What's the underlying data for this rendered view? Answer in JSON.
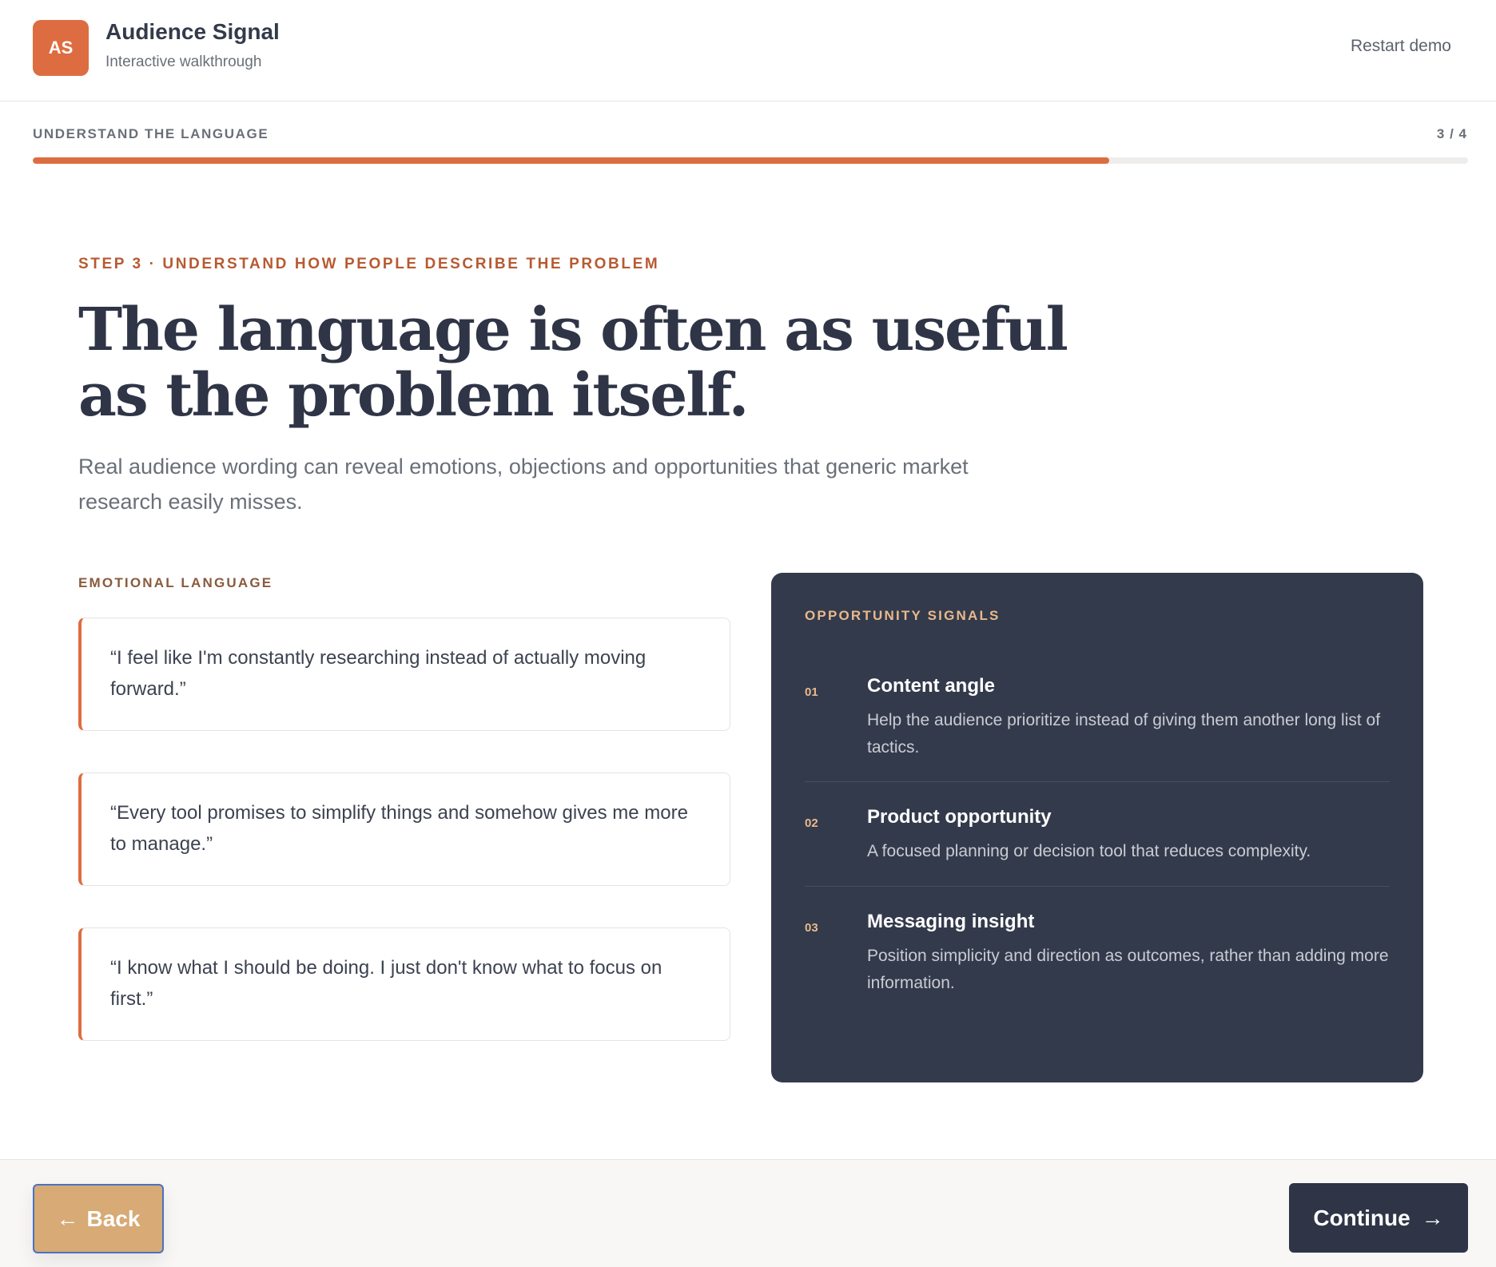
{
  "header": {
    "logo_text": "AS",
    "app_title": "Audience Signal",
    "app_subtitle": "Interactive walkthrough",
    "restart_label": "Restart demo"
  },
  "progress": {
    "label": "UNDERSTAND THE LANGUAGE",
    "count": "3 / 4",
    "fraction": 0.75,
    "accent_color": "#dd6d40"
  },
  "hero": {
    "eyebrow": "STEP 3 · UNDERSTAND HOW PEOPLE DESCRIBE THE PROBLEM",
    "headline": "The language is often as useful as the problem itself.",
    "lede": "Real audience wording can reveal emotions, objections and opportunities that generic market research easily misses."
  },
  "emotional": {
    "label": "EMOTIONAL LANGUAGE",
    "quotes": [
      "“I feel like I'm constantly researching instead of actually moving forward.”",
      "“Every tool promises to simplify things and somehow gives me more to manage.”",
      "“I know what I should be doing. I just don't know what to focus on first.”"
    ]
  },
  "opportunities": {
    "label": "OPPORTUNITY SIGNALS",
    "items": [
      {
        "num": "01",
        "title": "Content angle",
        "desc": "Help the audience prioritize instead of giving them another long list of tactics."
      },
      {
        "num": "02",
        "title": "Product opportunity",
        "desc": "A focused planning or decision tool that reduces complexity."
      },
      {
        "num": "03",
        "title": "Messaging insight",
        "desc": "Position simplicity and direction as outcomes, rather than adding more information."
      }
    ]
  },
  "footer": {
    "back_arrow": "←",
    "back_label": "Back",
    "continue_label": "Continue",
    "continue_arrow": "→"
  }
}
